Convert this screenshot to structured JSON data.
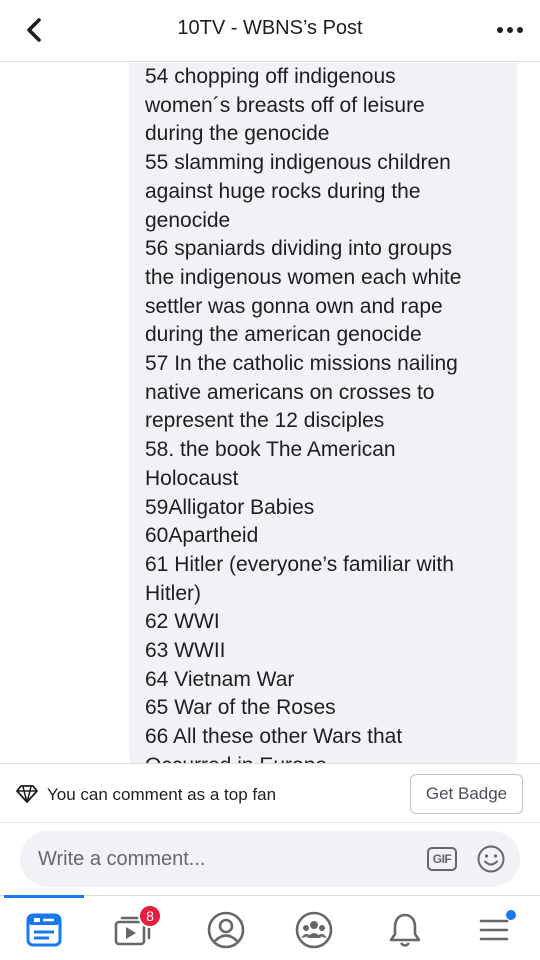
{
  "header": {
    "title": "10TV - WBNS’s Post",
    "back_icon": "chevron-left-icon",
    "more_icon": "more-dots-icon"
  },
  "comment": {
    "lines": [
      "54 chopping off indigenous",
      "women´s breasts off of leisure",
      "during the genocide",
      "55 slamming indigenous children",
      "against huge rocks during the",
      "genocide",
      "56 spaniards dividing into groups",
      "the indigenous women each white",
      "settler was gonna own and rape",
      "during the american genocide",
      "57 In the catholic missions nailing",
      "native americans on crosses to",
      "represent the 12 disciples",
      "58. the book The American",
      "Holocaust",
      "59Alligator Babies",
      "60Apartheid",
      "61 Hitler (everyone’s familiar with",
      "Hitler)",
      "62 WWI",
      "63 WWII",
      "64 Vietnam War",
      "65 War of the Roses",
      "66 All these other Wars that",
      "Occurred in Europe"
    ]
  },
  "topfan": {
    "text": "You can comment as a top fan",
    "button_label": "Get Badge",
    "icon": "diamond-icon"
  },
  "composer": {
    "placeholder": "Write a comment...",
    "gif_label": "GIF",
    "emoji_icon": "smiley-icon"
  },
  "bottom_nav": {
    "items": [
      "news-feed-icon",
      "watch-icon",
      "profile-icon",
      "groups-icon",
      "notifications-icon",
      "menu-icon"
    ],
    "watch_badge": "8"
  },
  "colors": {
    "accent": "#1877f2",
    "bubble": "#f0f2f5",
    "badge_red": "#e41e3f",
    "icon_gray": "#65676b"
  }
}
